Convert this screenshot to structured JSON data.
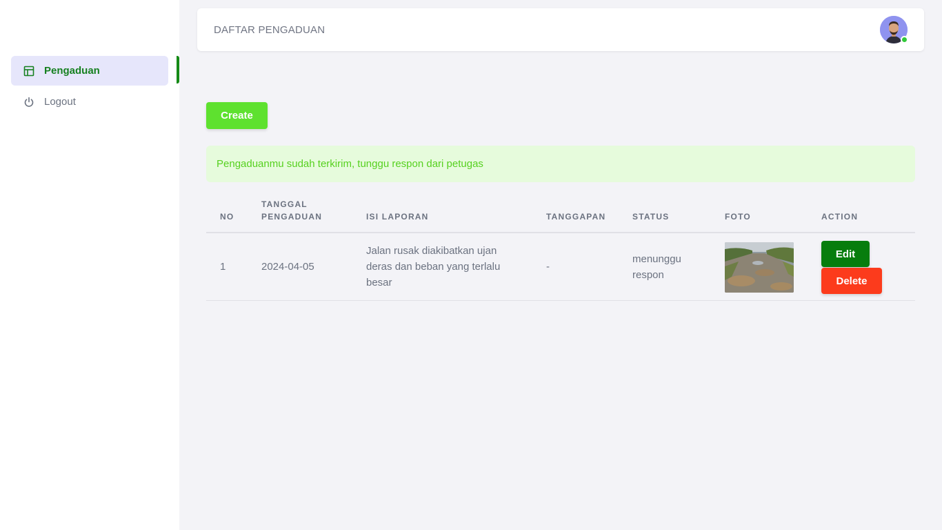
{
  "sidebar": {
    "items": [
      {
        "label": "Pengaduan",
        "icon": "layout-icon",
        "active": true
      },
      {
        "label": "Logout",
        "icon": "power-icon",
        "active": false
      }
    ]
  },
  "header": {
    "title": "DAFTAR PENGADUAN",
    "avatar_status": "online"
  },
  "actions": {
    "create_label": "Create"
  },
  "alert": {
    "message": "Pengaduanmu sudah terkirim, tunggu respon dari petugas"
  },
  "table": {
    "headers": {
      "no": "NO",
      "tanggal_line1": "TANGGAL",
      "tanggal_line2": "PENGADUAN",
      "isi": "ISI LAPORAN",
      "tanggapan": "TANGGAPAN",
      "status": "STATUS",
      "foto": "FOTO",
      "action": "ACTION"
    },
    "rows": [
      {
        "no": "1",
        "tanggal": "2024-04-05",
        "isi_line1": "Jalan rusak diakibatkan ujan",
        "isi_line2": "deras dan beban yang terlalu",
        "isi_line3": "besar",
        "tanggapan": "-",
        "status_line1": "menunggu",
        "status_line2": "respon",
        "edit_label": "Edit",
        "delete_label": "Delete"
      }
    ]
  },
  "colors": {
    "brand_green": "#158a16",
    "create_green": "#5ee12f",
    "alert_bg": "#e6fbdc",
    "alert_text": "#56d11f",
    "delete_red": "#fc3b1c",
    "edit_green": "#077d0d"
  }
}
